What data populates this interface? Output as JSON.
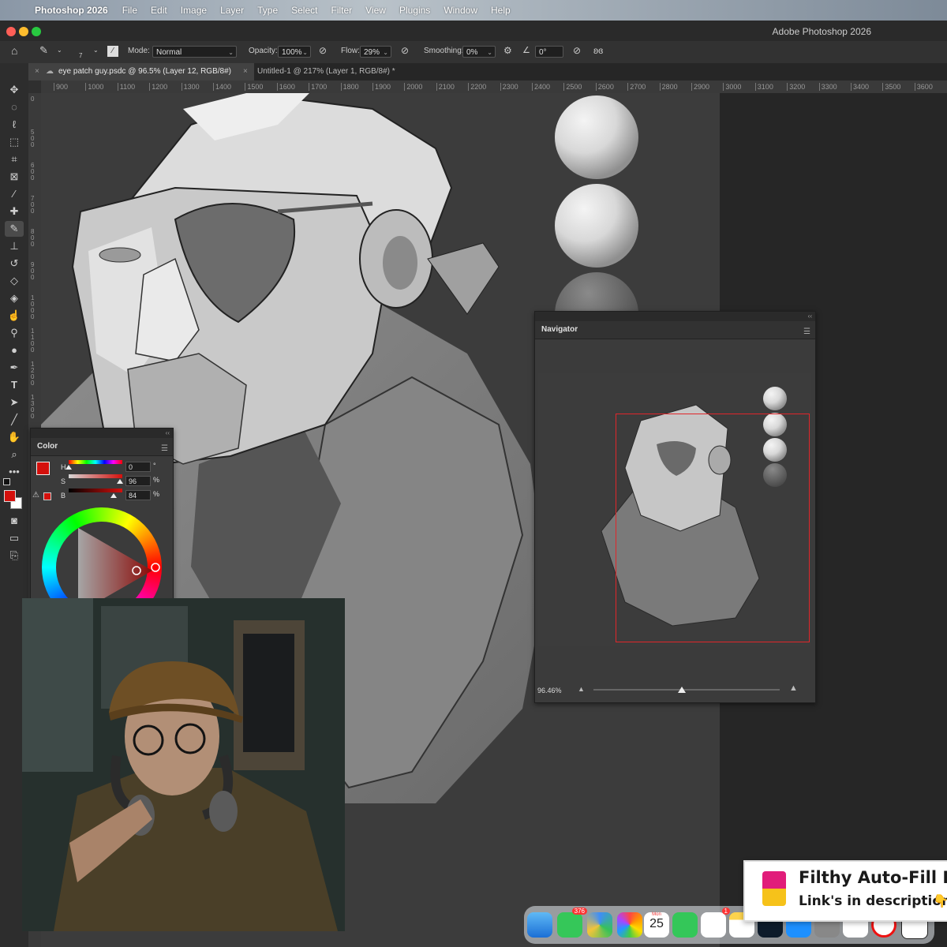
{
  "menubar": {
    "app_name": "Photoshop 2026",
    "items": [
      "File",
      "Edit",
      "Image",
      "Layer",
      "Type",
      "Select",
      "Filter",
      "View",
      "Plugins",
      "Window",
      "Help"
    ]
  },
  "window": {
    "title": "Adobe Photoshop 2026"
  },
  "options_bar": {
    "brush_size": "7",
    "mode_label": "Mode:",
    "mode_value": "Normal",
    "opacity_label": "Opacity:",
    "opacity_value": "100%",
    "flow_label": "Flow:",
    "flow_value": "29%",
    "smoothing_label": "Smoothing:",
    "smoothing_value": "0%",
    "angle_value": "0°"
  },
  "tabs": [
    {
      "label": "eye patch guy.psdc @ 96.5% (Layer 12, RGB/8#)",
      "active": true
    },
    {
      "label": "Untitled-1 @ 217% (Layer 1, RGB/8#) *",
      "active": false
    }
  ],
  "ruler_ticks": [
    "900",
    "1000",
    "1100",
    "1200",
    "1300",
    "1400",
    "1500",
    "1600",
    "1700",
    "1800",
    "1900",
    "2000",
    "2100",
    "2200",
    "2300",
    "2400",
    "2500",
    "2600",
    "2700",
    "2800",
    "2900",
    "3000",
    "3100",
    "3200",
    "3300",
    "3400",
    "3500",
    "3600"
  ],
  "vruler_ticks": [
    "0",
    "500",
    "600",
    "700",
    "800",
    "900",
    "1000",
    "1100",
    "1200",
    "1300",
    "1400"
  ],
  "color_panel": {
    "title": "Color",
    "h_label": "H",
    "h_value": "0",
    "h_unit": "°",
    "s_label": "S",
    "s_value": "96",
    "s_unit": "%",
    "b_label": "B",
    "b_value": "84",
    "b_unit": "%",
    "foreground": "#d4100c",
    "hue_fraction": 0.0,
    "saturation_fraction": 0.96,
    "brightness_fraction": 0.84
  },
  "navigator": {
    "title": "Navigator",
    "zoom": "96.46%",
    "zoom_slider_fraction": 0.47
  },
  "promo": {
    "line1": "Filthy Auto-Fill P",
    "line2": "Link's in description",
    "pointer": "👇"
  },
  "dock": {
    "messages_badge": "376",
    "reminders_badge": "1",
    "calendar_day": "Mon",
    "calendar_date": "25"
  },
  "colors": {
    "accent_red": "#d4100c",
    "navigator_frame": "#e0262a",
    "panel_bg": "#3b3b3b"
  }
}
